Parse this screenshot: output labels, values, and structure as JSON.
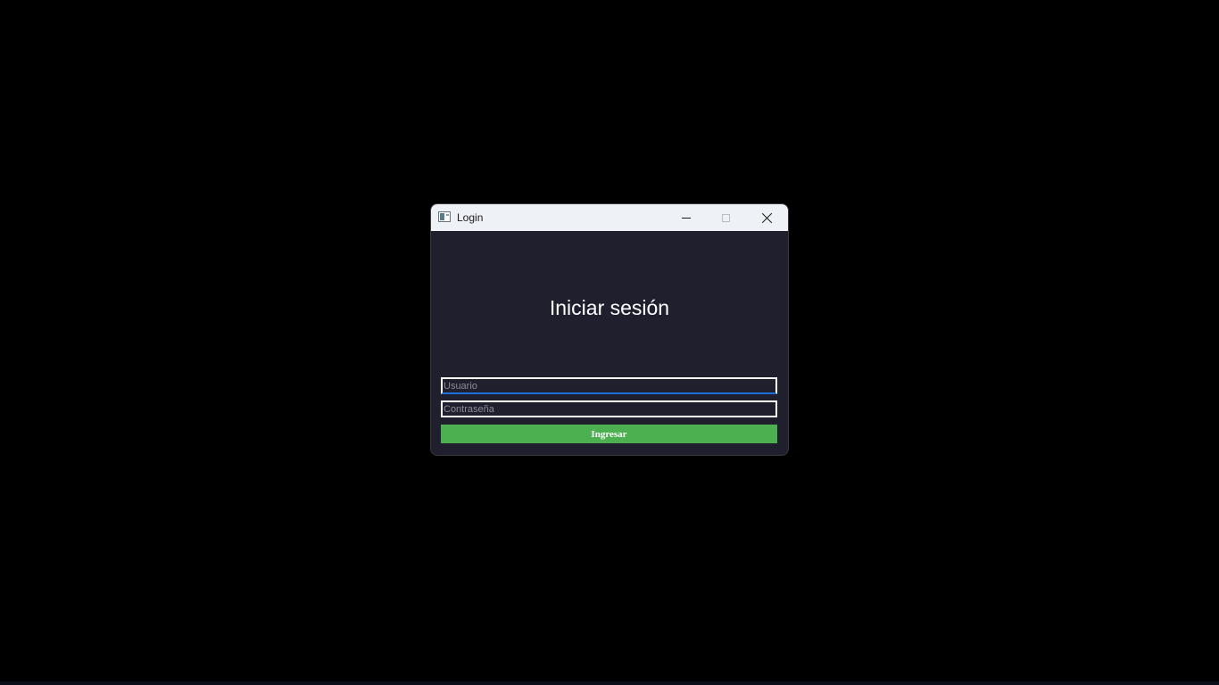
{
  "window": {
    "title": "Login",
    "app_icon": "window-app-icon",
    "controls": {
      "minimize_icon": "minimize-icon",
      "maximize_icon": "maximize-icon",
      "close_icon": "close-icon"
    }
  },
  "form": {
    "heading": "Iniciar sesión",
    "username": {
      "value": "",
      "placeholder": "Usuario"
    },
    "password": {
      "value": "",
      "placeholder": "Contraseña"
    },
    "submit_label": "Ingresar"
  },
  "colors": {
    "desktop_background": "#000000",
    "titlebar_background": "#eef1f6",
    "window_background": "#1f1f2e",
    "field_border": "#ffffff",
    "focus_accent": "#1e6fd9",
    "submit_background": "#4caf50",
    "text": "#ffffff"
  }
}
